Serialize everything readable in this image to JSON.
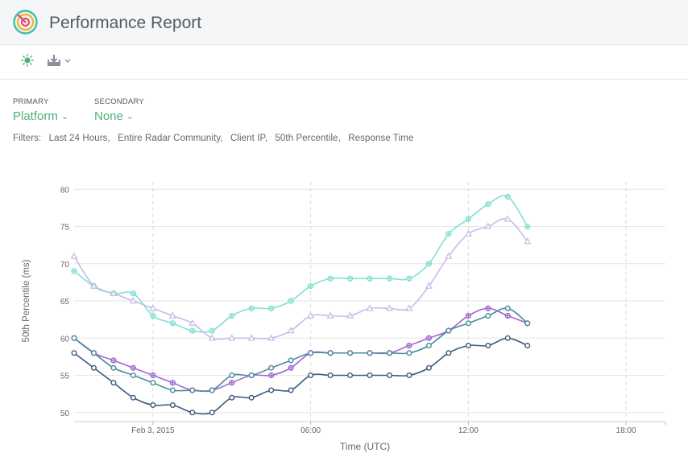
{
  "app": {
    "title": "Performance Report"
  },
  "toolbar": {
    "theme_icon": "sun-icon",
    "export_icon": "download-icon"
  },
  "selectors": {
    "primary": {
      "label": "PRIMARY",
      "value": "Platform"
    },
    "secondary": {
      "label": "SECONDARY",
      "value": "None"
    }
  },
  "filters": {
    "label": "Filters:",
    "items": [
      "Last 24 Hours,",
      "Entire Radar Community,",
      "Client IP,",
      "50th Percentile,",
      "Response Time"
    ]
  },
  "colors": {
    "accent": "#4fb07d",
    "series": [
      "#7fe0d0",
      "#c5bce8",
      "#a066d4",
      "#4a8a9c",
      "#3d5a80"
    ]
  },
  "chart_data": {
    "type": "line",
    "ylabel": "50th Percentile (ms)",
    "xlabel": "Time (UTC)",
    "ylim": [
      49,
      81
    ],
    "yticks": [
      50,
      55,
      60,
      65,
      70,
      75,
      80
    ],
    "xtick_labels": [
      {
        "hour": 2,
        "label": "Feb 3, 2015"
      },
      {
        "hour": 6,
        "label": "06:00"
      },
      {
        "hour": 10,
        "label": "12:00"
      },
      {
        "hour": 14,
        "label": "18:00"
      }
    ],
    "x": [
      0,
      0.5,
      1,
      1.5,
      2,
      2.5,
      3,
      3.5,
      4,
      4.5,
      5,
      5.5,
      6,
      6.5,
      7,
      7.5,
      8,
      8.5,
      9,
      9.5,
      10,
      10.5,
      11,
      11.5,
      12,
      12.5,
      13,
      13.5,
      14,
      14.5,
      15
    ],
    "series": [
      {
        "marker": "cross",
        "values": [
          69,
          67,
          66,
          66,
          63,
          62,
          61,
          61,
          63,
          64,
          64,
          65,
          67,
          68,
          68,
          68,
          68,
          68,
          70,
          74,
          76,
          78,
          79,
          75
        ]
      },
      {
        "marker": "triangle",
        "values": [
          71,
          67,
          66,
          65,
          64,
          63,
          62,
          60,
          60,
          60,
          60,
          61,
          63,
          63,
          63,
          64,
          64,
          64,
          67,
          71,
          74,
          75,
          76,
          73
        ]
      },
      {
        "marker": "cross",
        "values": [
          60,
          58,
          57,
          56,
          55,
          54,
          53,
          53,
          54,
          55,
          55,
          56,
          58,
          58,
          58,
          58,
          58,
          59,
          60,
          61,
          63,
          64,
          63,
          62
        ]
      },
      {
        "marker": "circle",
        "values": [
          60,
          58,
          56,
          55,
          54,
          53,
          53,
          53,
          55,
          55,
          56,
          57,
          58,
          58,
          58,
          58,
          58,
          58,
          59,
          61,
          62,
          63,
          64,
          62
        ]
      },
      {
        "marker": "circle",
        "values": [
          58,
          56,
          54,
          52,
          51,
          51,
          50,
          50,
          52,
          52,
          53,
          53,
          55,
          55,
          55,
          55,
          55,
          55,
          56,
          58,
          59,
          59,
          60,
          59
        ]
      }
    ]
  }
}
